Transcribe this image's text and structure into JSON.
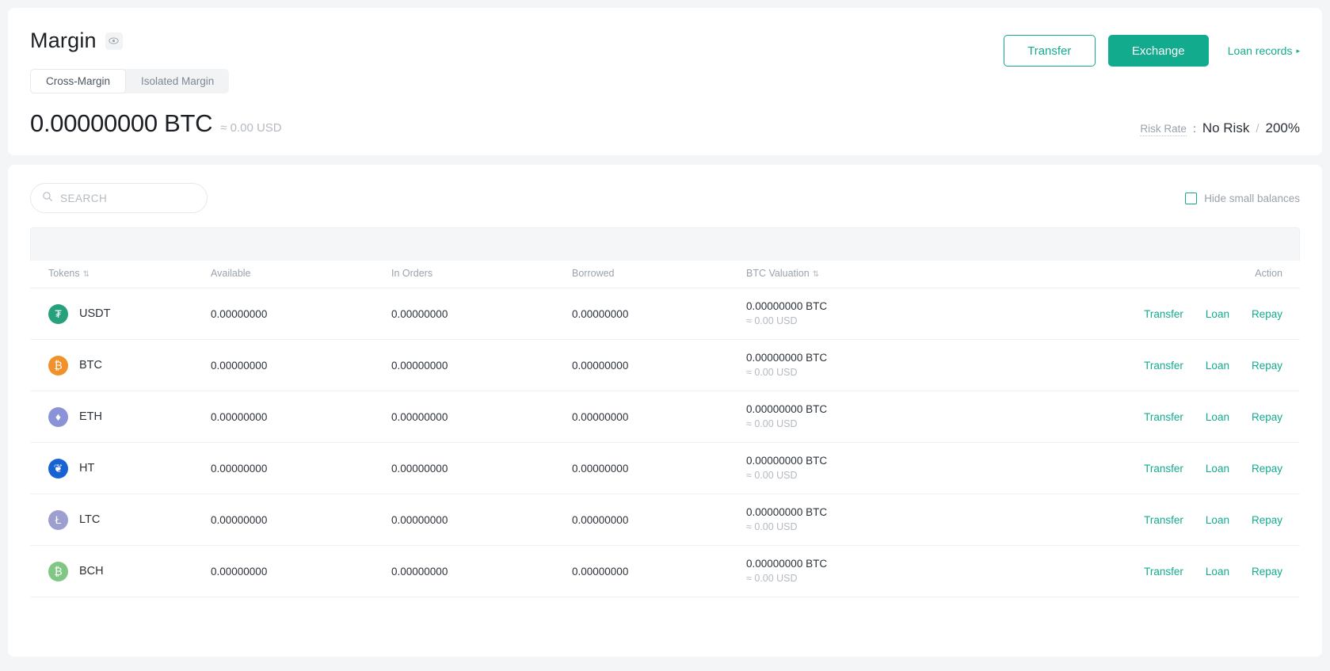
{
  "header": {
    "title": "Margin",
    "eye_icon": "eye-icon",
    "transfer_label": "Transfer",
    "exchange_label": "Exchange",
    "loan_records_label": "Loan records",
    "loan_records_caret": "▸"
  },
  "tabs": [
    {
      "label": "Cross-Margin",
      "active": true
    },
    {
      "label": "Isolated Margin",
      "active": false
    }
  ],
  "balance": {
    "amount": "0.00000000 BTC",
    "approx": "≈ 0.00 USD"
  },
  "risk": {
    "label": "Risk Rate",
    "colon": ":",
    "value": "No Risk",
    "separator": "/",
    "percent": "200%"
  },
  "search": {
    "placeholder": "SEARCH",
    "value": "",
    "icon": "search-icon"
  },
  "hide_small": {
    "label": "Hide small balances",
    "checked": false
  },
  "table": {
    "columns": [
      {
        "label": "Tokens",
        "sortable": true
      },
      {
        "label": "Available",
        "sortable": false
      },
      {
        "label": "In Orders",
        "sortable": false
      },
      {
        "label": "Borrowed",
        "sortable": false
      },
      {
        "label": "BTC Valuation",
        "sortable": true
      },
      {
        "label": "Action",
        "sortable": false
      }
    ],
    "sort_icon": "⇅",
    "actions": [
      "Transfer",
      "Loan",
      "Repay"
    ],
    "rows": [
      {
        "token": "USDT",
        "icon_glyph": "₮",
        "icon_color": "#26a17b",
        "available": "0.00000000",
        "in_orders": "0.00000000",
        "borrowed": "0.00000000",
        "valuation": "0.00000000 BTC",
        "valuation_usd": "≈ 0.00 USD"
      },
      {
        "token": "BTC",
        "icon_glyph": "₿",
        "icon_color": "#f0912a",
        "available": "0.00000000",
        "in_orders": "0.00000000",
        "borrowed": "0.00000000",
        "valuation": "0.00000000 BTC",
        "valuation_usd": "≈ 0.00 USD"
      },
      {
        "token": "ETH",
        "icon_glyph": "♦",
        "icon_color": "#8a92d8",
        "available": "0.00000000",
        "in_orders": "0.00000000",
        "borrowed": "0.00000000",
        "valuation": "0.00000000 BTC",
        "valuation_usd": "≈ 0.00 USD"
      },
      {
        "token": "HT",
        "icon_glyph": "❦",
        "icon_color": "#1763d4",
        "available": "0.00000000",
        "in_orders": "0.00000000",
        "borrowed": "0.00000000",
        "valuation": "0.00000000 BTC",
        "valuation_usd": "≈ 0.00 USD"
      },
      {
        "token": "LTC",
        "icon_glyph": "Ł",
        "icon_color": "#9c9fd0",
        "available": "0.00000000",
        "in_orders": "0.00000000",
        "borrowed": "0.00000000",
        "valuation": "0.00000000 BTC",
        "valuation_usd": "≈ 0.00 USD"
      },
      {
        "token": "BCH",
        "icon_glyph": "₿",
        "icon_color": "#81c784",
        "available": "0.00000000",
        "in_orders": "0.00000000",
        "borrowed": "0.00000000",
        "valuation": "0.00000000 BTC",
        "valuation_usd": "≈ 0.00 USD"
      }
    ]
  },
  "colors": {
    "accent": "#13ab8e",
    "text": "#2b3138",
    "muted": "#9aa2ab"
  }
}
